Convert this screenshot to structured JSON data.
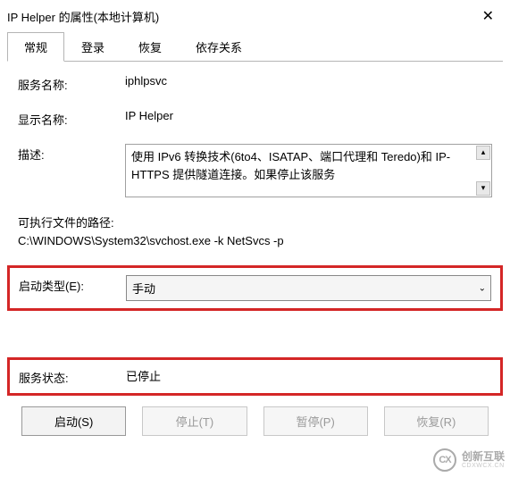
{
  "title": "IP Helper 的属性(本地计算机)",
  "tabs": {
    "general": "常规",
    "logon": "登录",
    "recovery": "恢复",
    "dependencies": "依存关系"
  },
  "labels": {
    "service_name": "服务名称:",
    "display_name": "显示名称:",
    "description": "描述:",
    "exe_path": "可执行文件的路径:",
    "startup_type": "启动类型(E):",
    "service_status": "服务状态:"
  },
  "values": {
    "service_name": "iphlpsvc",
    "display_name": "IP Helper",
    "description": "使用 IPv6 转换技术(6to4、ISATAP、端口代理和 Teredo)和 IP-HTTPS 提供隧道连接。如果停止该服务",
    "exe_path": "C:\\WINDOWS\\System32\\svchost.exe -k NetSvcs -p",
    "startup_type": "手动",
    "service_status": "已停止"
  },
  "buttons": {
    "start": "启动(S)",
    "stop": "停止(T)",
    "pause": "暂停(P)",
    "resume": "恢复(R)"
  },
  "watermark": {
    "logo": "CX",
    "text": "创新互联",
    "sub": "CDXWCX.CN"
  }
}
